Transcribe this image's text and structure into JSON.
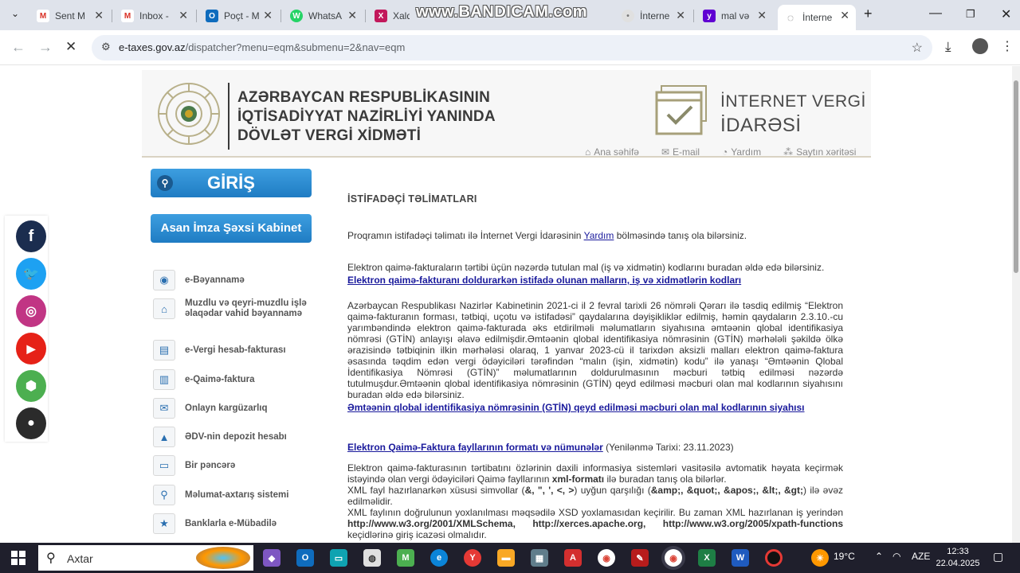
{
  "browser": {
    "tabs": [
      {
        "label": "Sent M",
        "icon": "gmail-icon",
        "color": "#d93025",
        "glyph": "M"
      },
      {
        "label": "Inbox -",
        "icon": "gmail-icon",
        "color": "#d93025",
        "glyph": "M"
      },
      {
        "label": "Poçt - M",
        "icon": "outlook-icon",
        "color": "#0f6cbd",
        "glyph": "O"
      },
      {
        "label": "WhatsA",
        "icon": "whatsapp-icon",
        "color": "#25d366",
        "glyph": "W"
      },
      {
        "label": "XalqO",
        "icon": "xalq-icon",
        "color": "#c2185b",
        "glyph": "X"
      },
      {
        "label": "İnterne",
        "icon": "tax-site-icon",
        "color": "#9e9e9e",
        "glyph": "•"
      },
      {
        "label": "mal və",
        "icon": "yahoo-icon",
        "color": "#6001d2",
        "glyph": "y"
      },
      {
        "label": "İnterne",
        "icon": "loading-icon",
        "color": "#6d6d6d",
        "glyph": "◌"
      }
    ],
    "watermark": "www.BANDICAM.com",
    "url_host": "e-taxes.gov.az",
    "url_path": "/dispatcher?menu=eqm&submenu=2&nav=eqm"
  },
  "header": {
    "title_line1": "AZƏRBAYCAN RESPUBLİKASININ",
    "title_line2": "İQTİSADİYYAT NAZİRLİYİ YANINDA",
    "title_line3": "DÖVLƏT VERGİ XİDMƏTİ",
    "ivi_line1": "İNTERNET VERGİ",
    "ivi_line2": "İDARƏSİ",
    "links": [
      "Ana səhifə",
      "E-mail",
      "Yardım",
      "Saytın xəritəsi"
    ]
  },
  "sidebar": {
    "login_label": "GİRİŞ",
    "asan_label": "Asan İmza Şəxsi Kabinet",
    "menu": [
      "e-Bəyannamə",
      "Muzdlu və qeyri-muzdlu işlə əlaqədar vahid bəyannamə",
      "e-Vergi hesab-fakturası",
      "e-Qaimə-faktura",
      "Onlayn kargüzarlıq",
      "ƏDV-nin depozit hesabı",
      "Bir pəncərə",
      "Məlumat-axtarış sistemi",
      "Banklarla e-Mübadilə"
    ]
  },
  "content": {
    "title": "İSTİFADƏÇİ TƏLİMATLARI",
    "p1_before": "Proqramın istifadəçi təlimatı ilə İnternet Vergi İdarəsinin ",
    "p1_link": "Yardım",
    "p1_after": " bölməsində tanış ola bilərsiniz.",
    "p2_text": "Elektron qaimə-fakturaların tərtibi üçün nəzərdə tutulan mal (iş və xidmətin) kodlarını buradan əldə edə bilərsiniz.",
    "p2_link": "Elektron qaimə-fakturanı doldurarkən istifadə olunan malların, iş və xidmətlərin kodları",
    "p3_text": "Azərbaycan Respublikası Nazirlər Kabinetinin 2021-ci il 2 fevral tarixli 26 nömrəli Qərarı ilə təsdiq edilmiş “Elektron qaimə-fakturanın forması, tətbiqi, uçotu və istifadəsi” qaydalarına dəyişikliklər edilmiş, həmin qaydaların 2.3.10.-cu yarımbəndində elektron qaimə-fakturada əks etdirilməli məlumatların siyahısına əmtəənin qlobal identifikasiya nömrəsi (GTİN) anlayışı əlavə edilmişdir.Əmtəənin qlobal identifikasiya nömrəsinin (GTİN) mərhələli şəkildə ölkə ərazisində tətbiqinin ilkin mərhələsi olaraq, 1 yanvar 2023-cü il tarixdən aksizli malları elektron qaimə-faktura əsasında təqdim edən vergi ödəyiciləri tərəfindən “malın (işin, xidmətin) kodu” ilə yanaşı “Əmtəənin Qlobal İdentifikasiya Nömrəsi (GTİN)” məlumatlarının doldurulmasının məcburi tətbiq edilməsi nəzərdə tutulmuşdur.Əmtəənin qlobal identifikasiya nömrəsinin (GTİN) qeyd edilməsi məcburi olan mal kodlarının siyahısını buradan əldə edə bilərsiniz.",
    "p3_link": "Əmtəənin qlobal identifikasiya nömrəsinin (GTİN) qeyd edilməsi məcburi olan mal kodlarının siyahısı",
    "p4_link": "Elektron Qaimə-Faktura fayllarının  formatı və nümunələr",
    "p4_after": " (Yenilənmə Tarixi: 23.11.2023)",
    "p5_a": "Elektron qaimə-fakturasının tərtibatını özlərinin daxili informasiya sistemləri vasitəsilə avtomatik həyata keçirmək istəyində olan vergi ödəyiciləri  Qaimə fayllarının ",
    "p5_bold": "xml-formatı",
    "p5_b": " ilə buradan tanış ola bilərlər.",
    "p6_a": "XML fayl hazırlanarkən xüsusi simvollar (",
    "p6_b1": "&, \", ', <, >",
    "p6_c": ") uyğun qarşılığı (",
    "p6_b2": "&amp;, &quot;, &apos;, &lt;, &gt;",
    "p6_d": ") ilə əvəz edilməlidir.",
    "p7_a": "XML faylının doğrulunun yoxlanılması məqsədilə XSD yoxlamasıdan keçirilir. Bu zaman XML hazırlanan iş yerindən ",
    "p7_b": "http://www.w3.org/2001/XMLSchema,  http://xerces.apache.org,  http://www.w3.org/2005/xpath-functions",
    "p7_c": " keçidlərinə giriş icazəsi olmalıdır."
  },
  "taskbar": {
    "search_placeholder": "Axtar",
    "temperature": "19°C",
    "language": "AZE",
    "time": "12:33",
    "date": "22.04.2025"
  }
}
